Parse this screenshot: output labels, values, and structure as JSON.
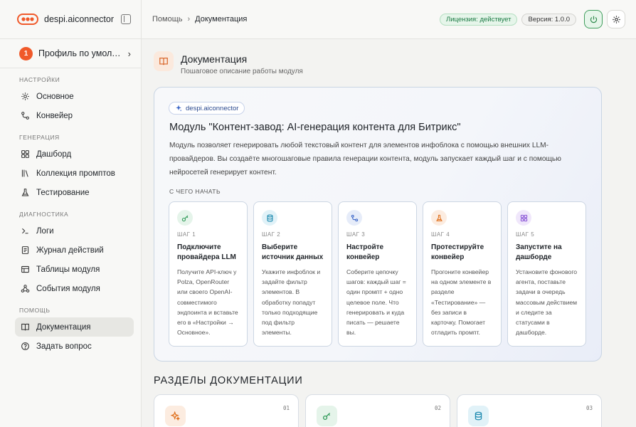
{
  "brand": {
    "name": "despi.aiconnector"
  },
  "profile": {
    "avatar_text": "1",
    "name": "Профиль по умолчанию"
  },
  "sidebar": {
    "groups": [
      {
        "title": "НАСТРОЙКИ",
        "items": [
          {
            "label": "Основное",
            "icon": "gear-icon"
          },
          {
            "label": "Конвейер",
            "icon": "pipeline-icon"
          }
        ]
      },
      {
        "title": "ГЕНЕРАЦИЯ",
        "items": [
          {
            "label": "Дашборд",
            "icon": "dashboard-icon"
          },
          {
            "label": "Коллекция промптов",
            "icon": "library-icon"
          },
          {
            "label": "Тестирование",
            "icon": "flask-icon"
          }
        ]
      },
      {
        "title": "ДИАГНОСТИКА",
        "items": [
          {
            "label": "Логи",
            "icon": "terminal-icon"
          },
          {
            "label": "Журнал действий",
            "icon": "journal-icon"
          },
          {
            "label": "Таблицы модуля",
            "icon": "table-icon"
          },
          {
            "label": "События модуля",
            "icon": "webhook-icon"
          }
        ]
      },
      {
        "title": "ПОМОЩЬ",
        "items": [
          {
            "label": "Документация",
            "icon": "book-icon",
            "active": true
          },
          {
            "label": "Задать вопрос",
            "icon": "help-icon"
          }
        ]
      }
    ]
  },
  "topbar": {
    "breadcrumb": [
      "Помощь",
      "Документация"
    ],
    "license_badge": "Лицензия: действует",
    "version_badge": "Версия: 1.0.0"
  },
  "page": {
    "title": "Документация",
    "subtitle": "Пошаговое описание работы модуля"
  },
  "hero": {
    "pill": "despi.aiconnector",
    "title": "Модуль \"Контент-завод: AI-генерация контента для Битрикс\"",
    "description": "Модуль позволяет генерировать любой текстовый контент для элементов инфоблока с помощью внешних LLM-провайдеров. Вы создаёте многошаговые правила генерации контента, модуль запускает каждый шаг и с помощью нейросетей генерирует контент.",
    "section_label": "С ЧЕГО НАЧАТЬ",
    "steps": [
      {
        "num": "ШАГ 1",
        "title": "Подключите провайдера LLM",
        "text": "Получите API-ключ у Polza, OpenRouter или своего OpenAI-совместимого эндпоинта и вставьте его в «Настройки → Основное».",
        "icon": "key-icon",
        "color": "#2f9a58",
        "bg": "#e5f4ea"
      },
      {
        "num": "ШАГ 2",
        "title": "Выберите источник данных",
        "text": "Укажите инфоблок и задайте фильтр элементов. В обработку попадут только подходящие под фильтр элементы.",
        "icon": "database-icon",
        "color": "#1f8bb0",
        "bg": "#e1f2f8"
      },
      {
        "num": "ШАГ 3",
        "title": "Настройте конвейер",
        "text": "Соберите цепочку шагов: каждый шаг = один промпт + одно целевое поле. Что генерировать и куда писать — решаете вы.",
        "icon": "pipeline-icon",
        "color": "#3e68c8",
        "bg": "#e6ecf9"
      },
      {
        "num": "ШАГ 4",
        "title": "Протестируйте конвейер",
        "text": "Прогоните конвейер на одном элементе в разделе «Тестирование» — без записи в карточку. Помогает отладить промпт.",
        "icon": "flask-icon",
        "color": "#e0721f",
        "bg": "#fcece0"
      },
      {
        "num": "ШАГ 5",
        "title": "Запустите на дашборде",
        "text": "Установите фонового агента, поставьте задачи в очередь массовым действием и следите за статусами в дашборде.",
        "icon": "dashboard-icon",
        "color": "#8a55d6",
        "bg": "#f0e7fb"
      }
    ]
  },
  "sections": {
    "title": "РАЗДЕЛЫ ДОКУМЕНТАЦИИ",
    "cards": [
      {
        "num": "01",
        "icon": "sparkle-icon",
        "color": "#e0721f",
        "bg": "#fcece0"
      },
      {
        "num": "02",
        "icon": "key-icon",
        "color": "#2f9a58",
        "bg": "#e5f4ea"
      },
      {
        "num": "03",
        "icon": "database-icon",
        "color": "#1f8bb0",
        "bg": "#e1f2f8"
      }
    ]
  }
}
